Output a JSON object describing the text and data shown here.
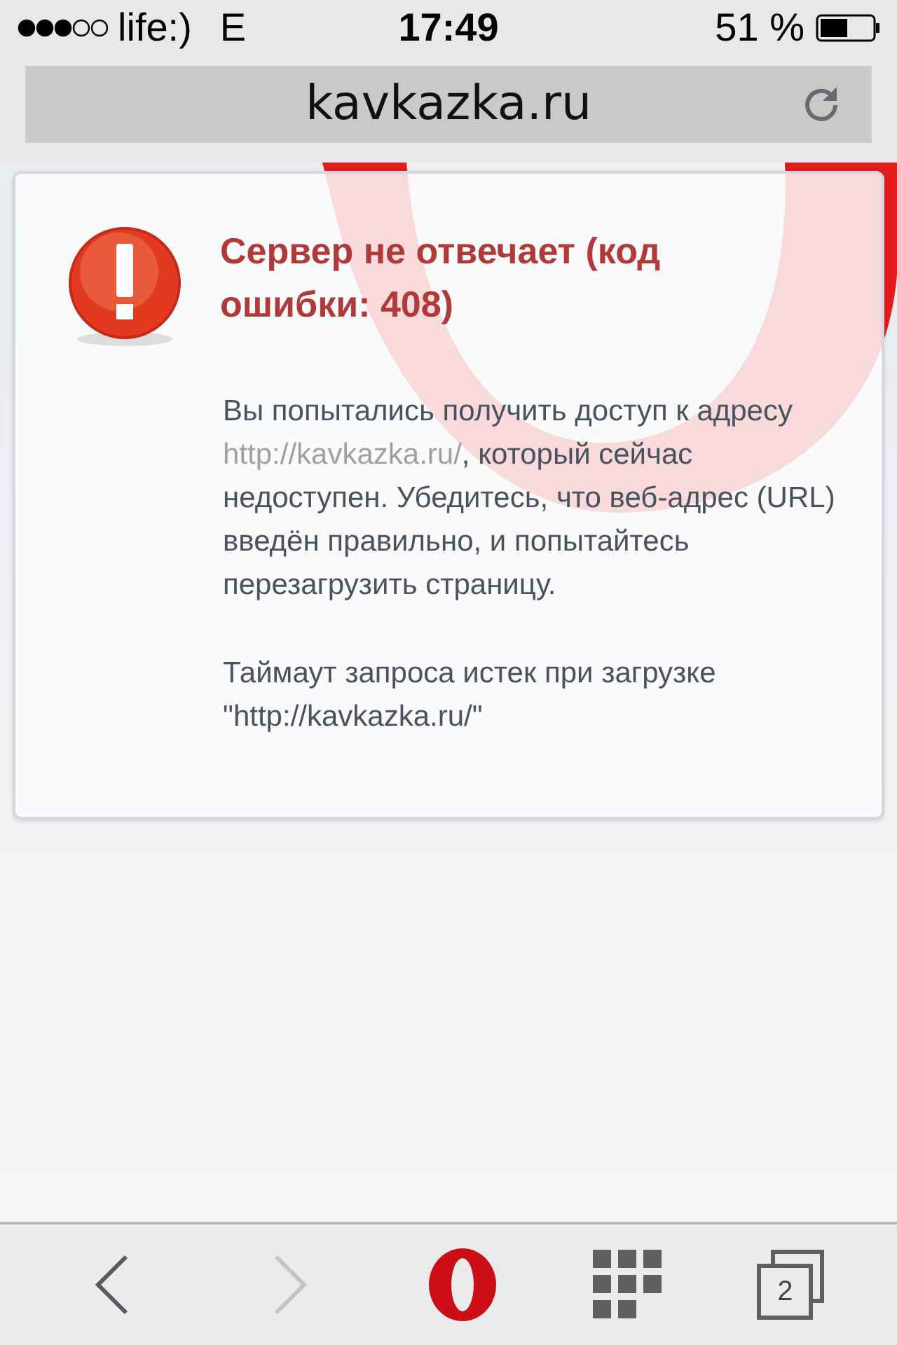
{
  "status_bar": {
    "carrier": "life:)",
    "network": "E",
    "time": "17:49",
    "battery": "51 %"
  },
  "address_bar": {
    "value": "kavkazka.ru"
  },
  "error": {
    "title": "Сервер не отвечает (код ошибки: 408)",
    "message": {
      "before": "Вы попытались получить доступ к адресу ",
      "link": "http://kavkazka.ru/",
      "after": ", который сейчас недоступен. Убедитесь, что веб-адрес (URL) введён правильно, и попытайтесь перезагрузить страницу."
    },
    "detail": "Таймаут запроса истек при загрузке \"http://kavkazka.ru/\""
  },
  "toolbar": {
    "back": {
      "disabled": false
    },
    "forward": {
      "disabled": true
    },
    "tab_count": "2"
  }
}
